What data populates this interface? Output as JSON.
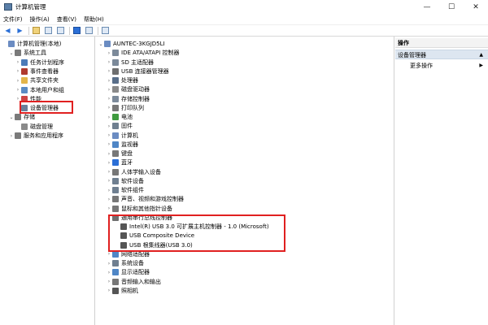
{
  "window": {
    "title": "计算机管理"
  },
  "menu": [
    "文件(F)",
    "操作(A)",
    "查看(V)",
    "帮助(H)"
  ],
  "left_tree": [
    {
      "label": "计算机管理(本地)",
      "level": 0,
      "icon": "computer-icon",
      "color": "#6b8cc2",
      "caret": "",
      "name": "computer-management-local"
    },
    {
      "label": "系统工具",
      "level": 1,
      "icon": "tools-icon",
      "color": "#7a7a7a",
      "caret": "⌄",
      "name": "system-tools"
    },
    {
      "label": "任务计划程序",
      "level": 2,
      "icon": "clock-icon",
      "color": "#4c7bb8",
      "caret": "›",
      "name": "task-scheduler"
    },
    {
      "label": "事件查看器",
      "level": 2,
      "icon": "event-icon",
      "color": "#b03a2e",
      "caret": "›",
      "name": "event-viewer"
    },
    {
      "label": "共享文件夹",
      "level": 2,
      "icon": "folder-icon",
      "color": "#e3b54a",
      "caret": "›",
      "name": "shared-folders"
    },
    {
      "label": "本地用户和组",
      "level": 2,
      "icon": "users-icon",
      "color": "#5a8bc4",
      "caret": "›",
      "name": "local-users-groups"
    },
    {
      "label": "性能",
      "level": 2,
      "icon": "performance-icon",
      "color": "#c44",
      "caret": "›",
      "name": "performance"
    },
    {
      "label": "设备管理器",
      "level": 2,
      "icon": "device-manager-icon",
      "color": "#6b7f99",
      "caret": "",
      "name": "device-manager"
    },
    {
      "label": "存储",
      "level": 1,
      "icon": "storage-icon",
      "color": "#7a7a7a",
      "caret": "⌄",
      "name": "storage"
    },
    {
      "label": "磁盘管理",
      "level": 2,
      "icon": "disk-icon",
      "color": "#8a8a8a",
      "caret": "",
      "name": "disk-management"
    },
    {
      "label": "服务和应用程序",
      "level": 1,
      "icon": "services-icon",
      "color": "#7a7a7a",
      "caret": "›",
      "name": "services-apps"
    }
  ],
  "device_tree": [
    {
      "label": "AUNTEC-3KGJD5LI",
      "level": 0,
      "caret": "⌄",
      "icon": "computer-icon",
      "color": "#6b8cc2"
    },
    {
      "label": "IDE ATA/ATAPI 控制器",
      "level": 1,
      "caret": "›",
      "icon": "ide-icon",
      "color": "#7c8a9a"
    },
    {
      "label": "SD 主适配器",
      "level": 1,
      "caret": "›",
      "icon": "sd-icon",
      "color": "#7c8a9a"
    },
    {
      "label": "USB 连接器管理器",
      "level": 1,
      "caret": "›",
      "icon": "usb-icon",
      "color": "#6f6f6f"
    },
    {
      "label": "处理器",
      "level": 1,
      "caret": "›",
      "icon": "cpu-icon",
      "color": "#5a6f8a"
    },
    {
      "label": "磁盘驱动器",
      "level": 1,
      "caret": "›",
      "icon": "disk-icon",
      "color": "#8a8a8a"
    },
    {
      "label": "存储控制器",
      "level": 1,
      "caret": "›",
      "icon": "storage-controller-icon",
      "color": "#7c8a9a"
    },
    {
      "label": "打印队列",
      "level": 1,
      "caret": "›",
      "icon": "printer-icon",
      "color": "#777"
    },
    {
      "label": "电池",
      "level": 1,
      "caret": "›",
      "icon": "battery-icon",
      "color": "#3f9b3f"
    },
    {
      "label": "固件",
      "level": 1,
      "caret": "›",
      "icon": "firmware-icon",
      "color": "#6f7f90"
    },
    {
      "label": "计算机",
      "level": 1,
      "caret": "›",
      "icon": "computer-icon",
      "color": "#6b8cc2"
    },
    {
      "label": "监视器",
      "level": 1,
      "caret": "›",
      "icon": "monitor-icon",
      "color": "#4f86c6"
    },
    {
      "label": "键盘",
      "level": 1,
      "caret": "›",
      "icon": "keyboard-icon",
      "color": "#777"
    },
    {
      "label": "蓝牙",
      "level": 1,
      "caret": "›",
      "icon": "bluetooth-icon",
      "color": "#2b6fd6"
    },
    {
      "label": "人体学输入设备",
      "level": 1,
      "caret": "›",
      "icon": "hid-icon",
      "color": "#777"
    },
    {
      "label": "软件设备",
      "level": 1,
      "caret": "›",
      "icon": "software-device-icon",
      "color": "#6f7f90"
    },
    {
      "label": "软件组件",
      "level": 1,
      "caret": "›",
      "icon": "software-component-icon",
      "color": "#6f7f90"
    },
    {
      "label": "声音、视频和游戏控制器",
      "level": 1,
      "caret": "›",
      "icon": "sound-icon",
      "color": "#777"
    },
    {
      "label": "鼠标和其他指针设备",
      "level": 1,
      "caret": "›",
      "icon": "mouse-icon",
      "color": "#777"
    },
    {
      "label": "通用串行总线控制器",
      "level": 1,
      "caret": "⌄",
      "icon": "usb-icon",
      "color": "#6f6f6f"
    },
    {
      "label": "Intel(R) USB 3.0 可扩展主机控制器 - 1.0 (Microsoft)",
      "level": 2,
      "caret": "",
      "icon": "usb-plug-icon",
      "color": "#555"
    },
    {
      "label": "USB Composite Device",
      "level": 2,
      "caret": "",
      "icon": "usb-plug-icon",
      "color": "#555"
    },
    {
      "label": "USB 根集线器(USB 3.0)",
      "level": 2,
      "caret": "",
      "icon": "usb-plug-icon",
      "color": "#555"
    },
    {
      "label": "网络适配器",
      "level": 1,
      "caret": "›",
      "icon": "network-icon",
      "color": "#4f86c6"
    },
    {
      "label": "系统设备",
      "level": 1,
      "caret": "›",
      "icon": "system-device-icon",
      "color": "#6f7f90"
    },
    {
      "label": "显示适配器",
      "level": 1,
      "caret": "›",
      "icon": "display-adapter-icon",
      "color": "#4f86c6"
    },
    {
      "label": "音频输入和输出",
      "level": 1,
      "caret": "›",
      "icon": "audio-icon",
      "color": "#777"
    },
    {
      "label": "照相机",
      "level": 1,
      "caret": "›",
      "icon": "camera-icon",
      "color": "#555"
    }
  ],
  "actions": {
    "header": "操作",
    "selected": "设备管理器",
    "more": "更多操作"
  },
  "colors": {
    "highlight": "#e02020",
    "selection": "#dde6f0"
  }
}
